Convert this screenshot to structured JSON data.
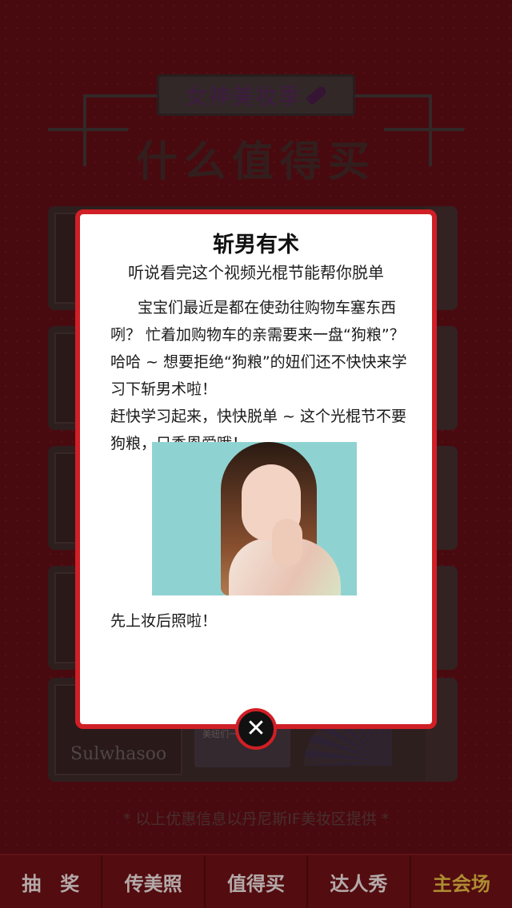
{
  "header": {
    "brand_title": "女神美妆季",
    "section_title": "什么值得买"
  },
  "cards": [
    {
      "brand": ""
    },
    {
      "brand": ""
    },
    {
      "brand": ""
    },
    {
      "brand": ""
    },
    {
      "brand": "Sulwhasoo",
      "promo_text": "美妞们一起来"
    }
  ],
  "footer_note": "* 以上优惠信息以丹尼斯IF美妆区提供 *",
  "tabs": [
    {
      "label": "抽　奖",
      "active": false
    },
    {
      "label": "传美照",
      "active": false
    },
    {
      "label": "值得买",
      "active": false
    },
    {
      "label": "达人秀",
      "active": false
    },
    {
      "label": "主会场",
      "active": true
    }
  ],
  "modal": {
    "title": "斩男有术",
    "subtitle": "听说看完这个视频光棍节能帮你脱单",
    "paragraph1": "宝宝们最近是都在使劲往购物车塞东西咧？ 忙着加购物车的亲需要来一盘“狗粮”？ 哈哈 ~ 想要拒绝“狗粮”的妞们还不快快来学习下斩男术啦！",
    "paragraph2": "赶快学习起来，快快脱单 ~ 这个光棍节不要狗粮，只秀恩爱哦！",
    "caption": "先上妆后照啦！",
    "close_icon": "✕"
  },
  "colors": {
    "background": "#5a0b13",
    "modal_border": "#d01f26",
    "tab_active": "#f6d44a",
    "tab_text": "#ffffff"
  }
}
